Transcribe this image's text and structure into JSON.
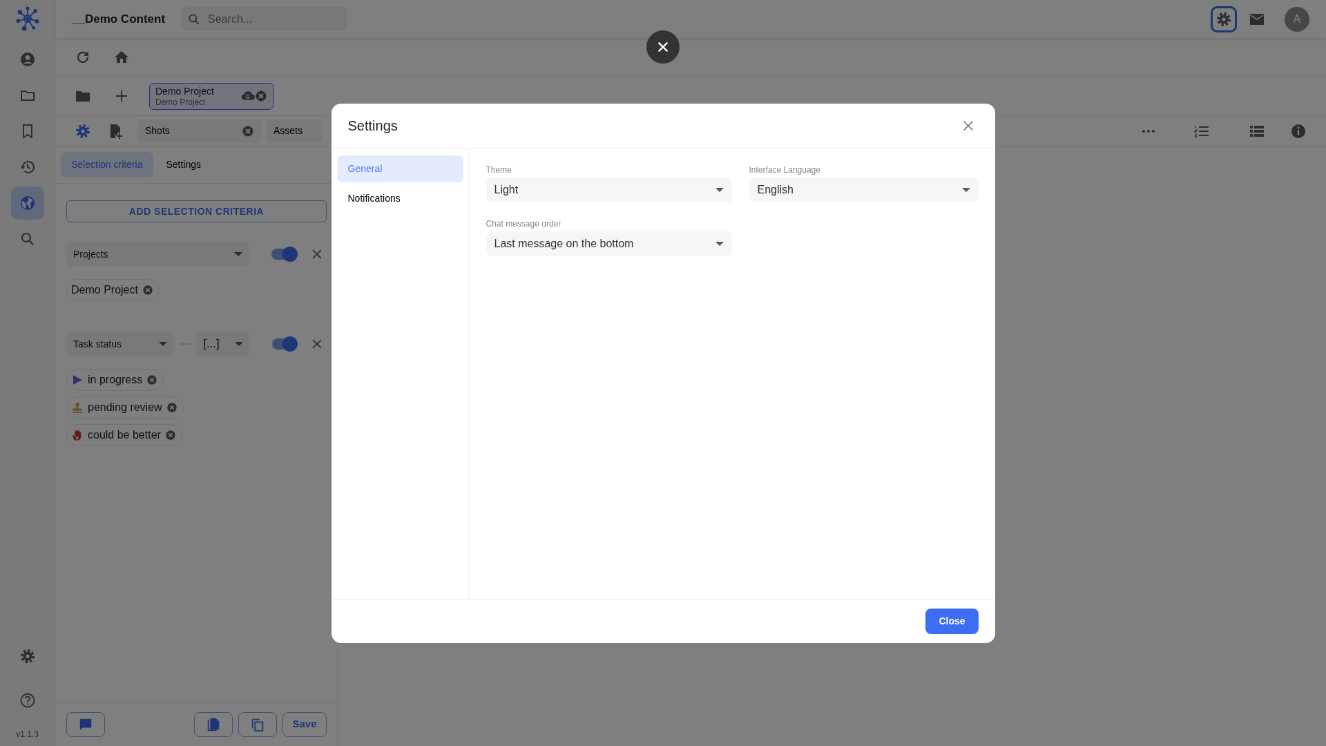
{
  "app": {
    "title": "__Demo Content",
    "search": {
      "placeholder": "Search..."
    },
    "settings_focused": true,
    "avatar": "A",
    "version": "v1.1.3"
  },
  "rail_items": [
    {
      "selected": false
    },
    {
      "selected": false
    },
    {
      "selected": false
    },
    {
      "selected": false
    },
    {
      "selected": true
    },
    {
      "selected": false
    }
  ],
  "project_tabs": [
    {
      "title": "Demo Project",
      "subtitle": "Demo Project"
    }
  ],
  "entity_tabs": [
    {
      "label": "Shots",
      "closable": true
    },
    {
      "label": "Assets",
      "closable": false
    }
  ],
  "panel_tabs": [
    {
      "label": "Selection criteria",
      "selected": true
    },
    {
      "label": "Settings",
      "selected": false
    }
  ],
  "add_button": "ADD SELECTION CRITERIA",
  "criteria": [
    {
      "field": "Projects",
      "enabled": true,
      "values": [
        {
          "label": "Demo Project",
          "kind": "plain"
        }
      ]
    },
    {
      "field": "Task status",
      "operator": "[...]",
      "enabled": true,
      "values": [
        {
          "label": "in progress",
          "kind": "play"
        },
        {
          "label": "pending review",
          "kind": "stamp"
        },
        {
          "label": "could be better",
          "kind": "hand"
        }
      ]
    }
  ],
  "footer": {
    "save": "Save"
  },
  "modal": {
    "title": "Settings",
    "nav": [
      {
        "label": "General",
        "selected": true
      },
      {
        "label": "Notifications",
        "selected": false
      }
    ],
    "fields": [
      {
        "label": "Theme",
        "value": "Light"
      },
      {
        "label": "Interface Language",
        "value": "English"
      },
      {
        "label": "Chat message order",
        "value": "Last message on the bottom"
      }
    ],
    "close_button": "Close"
  }
}
